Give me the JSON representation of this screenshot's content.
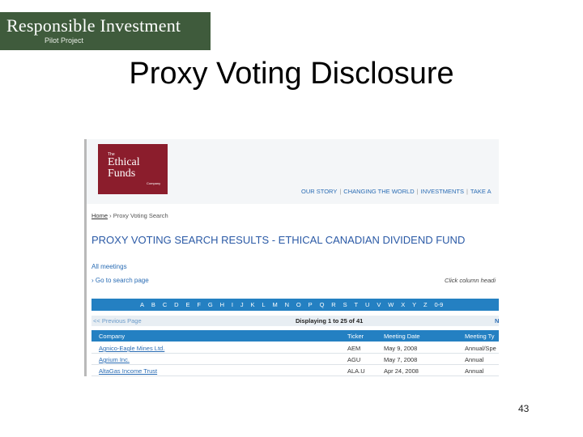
{
  "logo": {
    "title": "Responsible Investment",
    "subtitle": "Pilot Project"
  },
  "slide": {
    "title": "Proxy Voting Disclosure",
    "number": "43"
  },
  "site": {
    "brand": {
      "the": "The",
      "line1": "Ethical",
      "line2": "Funds",
      "company": "Company"
    },
    "nav": [
      "OUR STORY",
      "CHANGING THE WORLD",
      "INVESTMENTS",
      "TAKE A"
    ],
    "breadcrumb": {
      "home": "Home",
      "sep": " › ",
      "current": "Proxy Voting Search"
    },
    "results_title": "PROXY VOTING SEARCH RESULTS - ETHICAL CANADIAN DIVIDEND FUND",
    "all_meetings": "All meetings",
    "go_search": "› Go to search page",
    "hint": "Click column headi",
    "letters": [
      "A",
      "B",
      "C",
      "D",
      "E",
      "F",
      "G",
      "H",
      "I",
      "J",
      "K",
      "L",
      "M",
      "N",
      "O",
      "P",
      "Q",
      "R",
      "S",
      "T",
      "U",
      "V",
      "W",
      "X",
      "Y",
      "Z",
      "0-9"
    ],
    "pager": {
      "previous": "<< Previous Page",
      "displaying": "Displaying 1 to 25 of 41",
      "next": "N"
    },
    "table": {
      "headers": [
        "Company",
        "Ticker",
        "Meeting Date",
        "Meeting Ty"
      ],
      "rows": [
        [
          "Agnico-Eagle Mines Ltd.",
          "AEM",
          "May 9, 2008",
          "Annual/Spe"
        ],
        [
          "Agrium Inc.",
          "AGU",
          "May 7, 2008",
          "Annual"
        ],
        [
          "AltaGas Income Trust",
          "ALA.U",
          "Apr 24, 2008",
          "Annual"
        ]
      ]
    }
  }
}
